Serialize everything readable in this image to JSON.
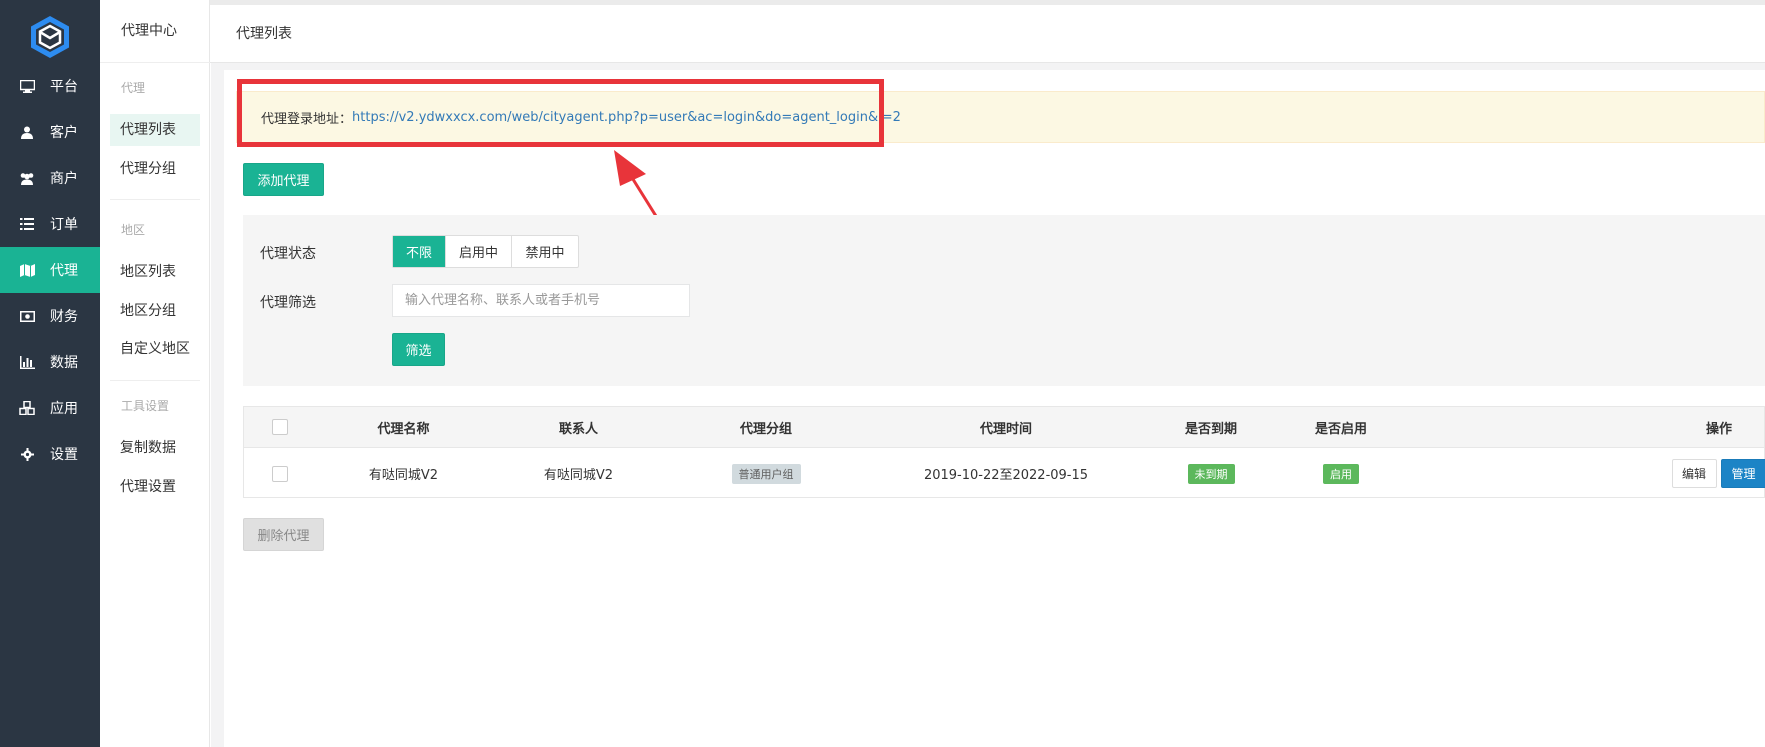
{
  "sidebar": {
    "items": [
      {
        "label": "平台",
        "icon": "monitor-icon",
        "active": false
      },
      {
        "label": "客户",
        "icon": "user-icon",
        "active": false
      },
      {
        "label": "商户",
        "icon": "users-icon",
        "active": false
      },
      {
        "label": "订单",
        "icon": "list-icon",
        "active": false
      },
      {
        "label": "代理",
        "icon": "map-icon",
        "active": true
      },
      {
        "label": "财务",
        "icon": "money-icon",
        "active": false
      },
      {
        "label": "数据",
        "icon": "bar-chart-icon",
        "active": false
      },
      {
        "label": "应用",
        "icon": "cubes-icon",
        "active": false
      },
      {
        "label": "设置",
        "icon": "gear-icon",
        "active": false
      }
    ]
  },
  "submenu": {
    "title": "代理中心",
    "sections": [
      {
        "title": "代理",
        "items": [
          "代理列表",
          "代理分组"
        ]
      },
      {
        "title": "地区",
        "items": [
          "地区列表",
          "地区分组",
          "自定义地区"
        ]
      },
      {
        "title": "工具设置",
        "items": [
          "复制数据",
          "代理设置"
        ]
      }
    ],
    "active_item": "代理列表"
  },
  "topbar": {
    "title": "代理列表"
  },
  "notice": {
    "label": "代理登录地址：",
    "url": "https://v2.ydwxxcx.com/web/cityagent.php?p=user&ac=login&do=agent_login&i=2"
  },
  "toolbar": {
    "add_label": "添加代理"
  },
  "filter": {
    "status_label": "代理状态",
    "status_options": [
      "不限",
      "启用中",
      "禁用中"
    ],
    "status_selected": "不限",
    "search_label": "代理筛选",
    "search_placeholder": "输入代理名称、联系人或者手机号",
    "search_value": "",
    "submit_label": "筛选"
  },
  "table": {
    "headers": [
      "代理名称",
      "联系人",
      "代理分组",
      "代理时间",
      "是否到期",
      "是否启用",
      "操作"
    ],
    "rows": [
      {
        "name": "有哒同城V2",
        "contact": "有哒同城V2",
        "group": "普通用户组",
        "time": "2019-10-22至2022-09-15",
        "expired": "未到期",
        "enabled": "启用",
        "edit_label": "编辑",
        "manage_label": "管理"
      }
    ]
  },
  "footer": {
    "delete_label": "删除代理"
  },
  "colors": {
    "sidebar_bg": "#2b3643",
    "accent": "#1ab394",
    "highlight_red": "#e8343a",
    "notice_bg": "#fcf8e3",
    "manage_blue": "#1c84c6"
  }
}
